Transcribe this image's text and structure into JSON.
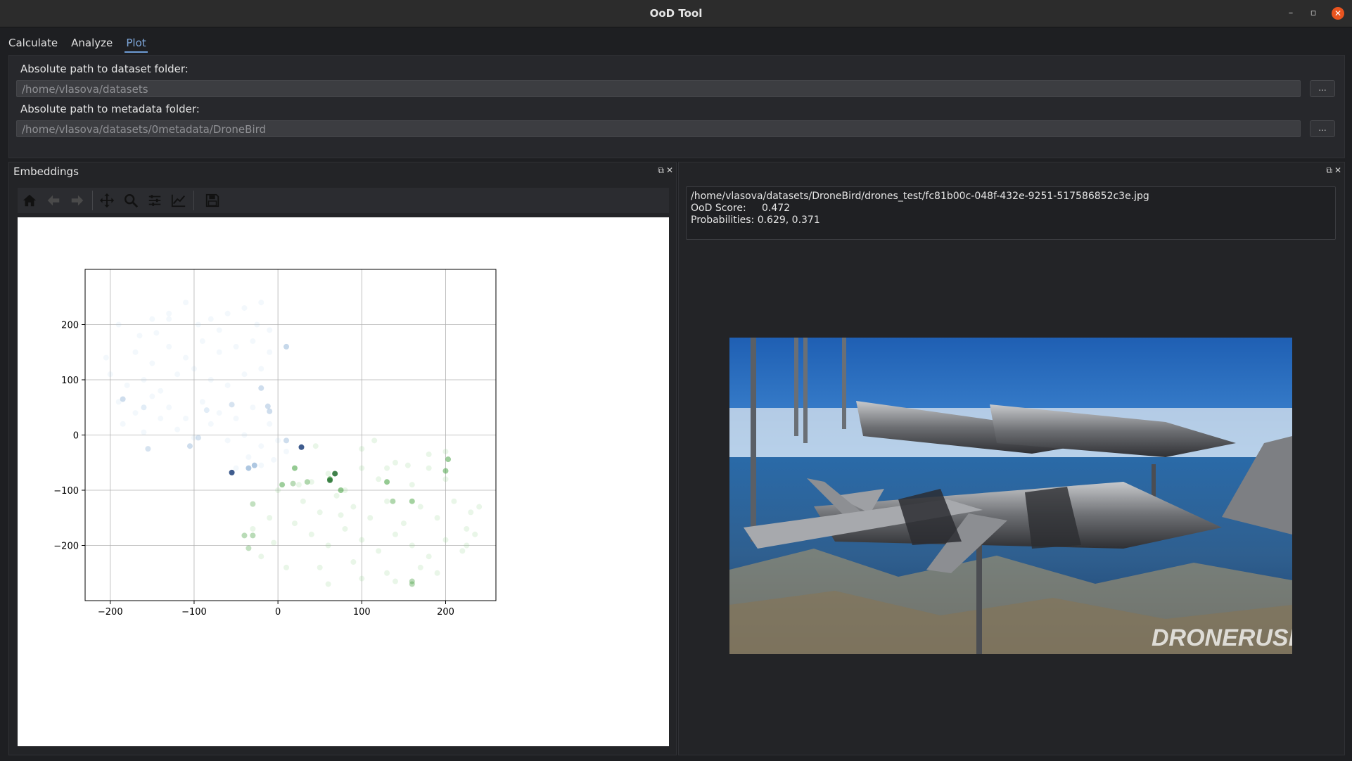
{
  "window": {
    "title": "OoD Tool",
    "minimize": "–",
    "maximize": "▫",
    "close": "✕"
  },
  "tabs": [
    {
      "label": "Calculate",
      "active": false
    },
    {
      "label": "Analyze",
      "active": false
    },
    {
      "label": "Plot",
      "active": true
    }
  ],
  "paths": {
    "dataset_label": "Absolute path to dataset folder:",
    "dataset_value": "/home/vlasova/datasets",
    "metadata_label": "Absolute path to metadata folder:",
    "metadata_value": "/home/vlasova/datasets/0metadata/DroneBird",
    "browse_label": "..."
  },
  "embeddings_panel": {
    "title": "Embeddings",
    "toolbar_icons": [
      "home-icon",
      "back-arrow-icon",
      "forward-arrow-icon",
      "pan-icon",
      "zoom-icon",
      "configure-subplots-icon",
      "edit-axis-icon",
      "save-icon"
    ]
  },
  "details": {
    "file_path": "/home/vlasova/datasets/DroneBird/drones_test/fc81b00c-048f-432e-9251-517586852c3e.jpg",
    "ood_score_label": "OoD Score:",
    "ood_score_value": "0.472",
    "probabilities_label": "Probabilities:",
    "probabilities_value": "0.629, 0.371",
    "image_watermark": "DRONERUSH"
  },
  "colors": {
    "accent": "#6d9bd4",
    "close_button": "#e9541f",
    "class_a": "#9ec5e6",
    "class_b": "#8fd08a"
  },
  "chart_data": {
    "type": "scatter",
    "title": "",
    "xlabel": "",
    "ylabel": "",
    "xlim": [
      -230,
      260
    ],
    "ylim": [
      -300,
      300
    ],
    "xticks": [
      -200,
      -100,
      0,
      100,
      200
    ],
    "yticks": [
      -200,
      -100,
      0,
      100,
      200
    ],
    "grid": true,
    "series": [
      {
        "color": "#9ec5e6",
        "points": [
          [
            -190,
            200
          ],
          [
            -165,
            180
          ],
          [
            -150,
            210
          ],
          [
            -130,
            220
          ],
          [
            -110,
            240
          ],
          [
            -95,
            200
          ],
          [
            -80,
            210
          ],
          [
            -60,
            220
          ],
          [
            -40,
            230
          ],
          [
            -20,
            240
          ],
          [
            -10,
            190
          ],
          [
            -170,
            150
          ],
          [
            -150,
            130
          ],
          [
            -130,
            160
          ],
          [
            -110,
            140
          ],
          [
            -90,
            170
          ],
          [
            -70,
            150
          ],
          [
            -50,
            160
          ],
          [
            -30,
            170
          ],
          [
            -10,
            150
          ],
          [
            -200,
            110
          ],
          [
            -180,
            90
          ],
          [
            -160,
            100
          ],
          [
            -140,
            80
          ],
          [
            -120,
            110
          ],
          [
            -100,
            120
          ],
          [
            -80,
            100
          ],
          [
            -60,
            90
          ],
          [
            -40,
            110
          ],
          [
            -20,
            120
          ],
          [
            -190,
            60
          ],
          [
            -170,
            40
          ],
          [
            -150,
            70
          ],
          [
            -130,
            50
          ],
          [
            -110,
            30
          ],
          [
            -90,
            60
          ],
          [
            -70,
            40
          ],
          [
            -50,
            30
          ],
          [
            -30,
            50
          ],
          [
            -10,
            20
          ],
          [
            -185,
            20
          ],
          [
            -160,
            5
          ],
          [
            -140,
            30
          ],
          [
            -120,
            10
          ],
          [
            -100,
            -5
          ],
          [
            -80,
            20
          ],
          [
            -60,
            -10
          ],
          [
            -40,
            0
          ],
          [
            -20,
            -20
          ],
          [
            0,
            -10
          ],
          [
            10,
            -30
          ],
          [
            -50,
            -60
          ],
          [
            -35,
            -40
          ],
          [
            -20,
            -55
          ],
          [
            -5,
            -45
          ],
          [
            -130,
            210
          ],
          [
            -70,
            190
          ],
          [
            -25,
            200
          ],
          [
            -145,
            185
          ],
          [
            -205,
            140
          ],
          [
            -160,
            50
          ],
          [
            -85,
            45
          ]
        ],
        "alphas": [
          0.12,
          0.12,
          0.12,
          0.12,
          0.12,
          0.12,
          0.12,
          0.12,
          0.12,
          0.12,
          0.12,
          0.12,
          0.12,
          0.12,
          0.12,
          0.12,
          0.12,
          0.12,
          0.12,
          0.12,
          0.12,
          0.12,
          0.12,
          0.12,
          0.12,
          0.12,
          0.12,
          0.12,
          0.12,
          0.12,
          0.12,
          0.12,
          0.12,
          0.12,
          0.12,
          0.12,
          0.12,
          0.12,
          0.12,
          0.12,
          0.12,
          0.12,
          0.12,
          0.12,
          0.12,
          0.12,
          0.12,
          0.12,
          0.12,
          0.12,
          0.12,
          0.12,
          0.12,
          0.12,
          0.12,
          0.12,
          0.12,
          0.12,
          0.12,
          0.12,
          0.3,
          0.3
        ]
      },
      {
        "color": "#8fd08a",
        "points": [
          [
            20,
            -60
          ],
          [
            40,
            -85
          ],
          [
            60,
            -70
          ],
          [
            80,
            -100
          ],
          [
            100,
            -60
          ],
          [
            120,
            -80
          ],
          [
            140,
            -50
          ],
          [
            160,
            -90
          ],
          [
            180,
            -60
          ],
          [
            200,
            -80
          ],
          [
            30,
            -120
          ],
          [
            50,
            -140
          ],
          [
            70,
            -110
          ],
          [
            90,
            -130
          ],
          [
            110,
            -150
          ],
          [
            130,
            -120
          ],
          [
            150,
            -160
          ],
          [
            170,
            -130
          ],
          [
            190,
            -150
          ],
          [
            210,
            -120
          ],
          [
            0,
            -100
          ],
          [
            20,
            -160
          ],
          [
            40,
            -180
          ],
          [
            60,
            -200
          ],
          [
            80,
            -170
          ],
          [
            100,
            -190
          ],
          [
            120,
            -210
          ],
          [
            140,
            -180
          ],
          [
            160,
            -200
          ],
          [
            180,
            -220
          ],
          [
            200,
            -190
          ],
          [
            220,
            -210
          ],
          [
            -10,
            -150
          ],
          [
            -30,
            -170
          ],
          [
            -20,
            -220
          ],
          [
            10,
            -240
          ],
          [
            50,
            -240
          ],
          [
            90,
            -230
          ],
          [
            130,
            -250
          ],
          [
            170,
            -240
          ],
          [
            60,
            -270
          ],
          [
            100,
            -260
          ],
          [
            140,
            -265
          ],
          [
            190,
            -250
          ],
          [
            225,
            -200
          ],
          [
            230,
            -140
          ],
          [
            240,
            -130
          ],
          [
            25,
            -90
          ],
          [
            45,
            -20
          ],
          [
            115,
            -10
          ],
          [
            155,
            -55
          ],
          [
            180,
            -35
          ],
          [
            235,
            -180
          ],
          [
            -5,
            -195
          ],
          [
            75,
            -145
          ],
          [
            100,
            -25
          ],
          [
            130,
            -60
          ],
          [
            160,
            -120
          ],
          [
            200,
            -30
          ],
          [
            225,
            -170
          ]
        ],
        "alphas": [
          0.2,
          0.2,
          0.2,
          0.2,
          0.2,
          0.2,
          0.2,
          0.2,
          0.2,
          0.2,
          0.2,
          0.2,
          0.2,
          0.2,
          0.2,
          0.2,
          0.2,
          0.2,
          0.2,
          0.2,
          0.2,
          0.2,
          0.2,
          0.2,
          0.2,
          0.2,
          0.2,
          0.2,
          0.2,
          0.2,
          0.2,
          0.2,
          0.2,
          0.2,
          0.2,
          0.2,
          0.2,
          0.2,
          0.2,
          0.2,
          0.2,
          0.2,
          0.2,
          0.2,
          0.2,
          0.2,
          0.2,
          0.2,
          0.2,
          0.2,
          0.2,
          0.2,
          0.2,
          0.2,
          0.2,
          0.2,
          0.2,
          0.2,
          0.2,
          0.2
        ]
      },
      {
        "color": "#5d8fc4",
        "points": [
          [
            10,
            160
          ],
          [
            -20,
            85
          ],
          [
            -12,
            52
          ],
          [
            -10,
            43
          ],
          [
            -55,
            55
          ],
          [
            -95,
            -5
          ],
          [
            -35,
            -60
          ],
          [
            -28,
            -55
          ],
          [
            -185,
            65
          ],
          [
            -155,
            -25
          ],
          [
            10,
            -10
          ],
          [
            -105,
            -20
          ]
        ],
        "alphas": [
          0.35,
          0.3,
          0.3,
          0.3,
          0.25,
          0.25,
          0.5,
          0.5,
          0.3,
          0.25,
          0.3,
          0.3
        ]
      },
      {
        "color": "#4fa64a",
        "points": [
          [
            20,
            -60
          ],
          [
            5,
            -90
          ],
          [
            62,
            -80
          ],
          [
            75,
            -100
          ],
          [
            130,
            -85
          ],
          [
            137,
            -120
          ],
          [
            160,
            -120
          ],
          [
            200,
            -65
          ],
          [
            203,
            -44
          ],
          [
            -40,
            -182
          ],
          [
            -30,
            -182
          ],
          [
            -35,
            -205
          ],
          [
            -30,
            -125
          ],
          [
            35,
            -85
          ],
          [
            18,
            -88
          ],
          [
            160,
            -265
          ],
          [
            160,
            -270
          ]
        ],
        "alphas": [
          0.55,
          0.55,
          0.7,
          0.6,
          0.6,
          0.45,
          0.45,
          0.55,
          0.55,
          0.4,
          0.4,
          0.35,
          0.35,
          0.45,
          0.4,
          0.4,
          0.4
        ]
      },
      {
        "color": "#1d3f7a",
        "points": [
          [
            28,
            -22
          ],
          [
            -55,
            -68
          ]
        ],
        "alphas": [
          0.85,
          0.85
        ]
      },
      {
        "color": "#1f6b2c",
        "points": [
          [
            68,
            -70
          ],
          [
            62,
            -82
          ]
        ],
        "alphas": [
          0.85,
          0.75
        ]
      }
    ]
  }
}
